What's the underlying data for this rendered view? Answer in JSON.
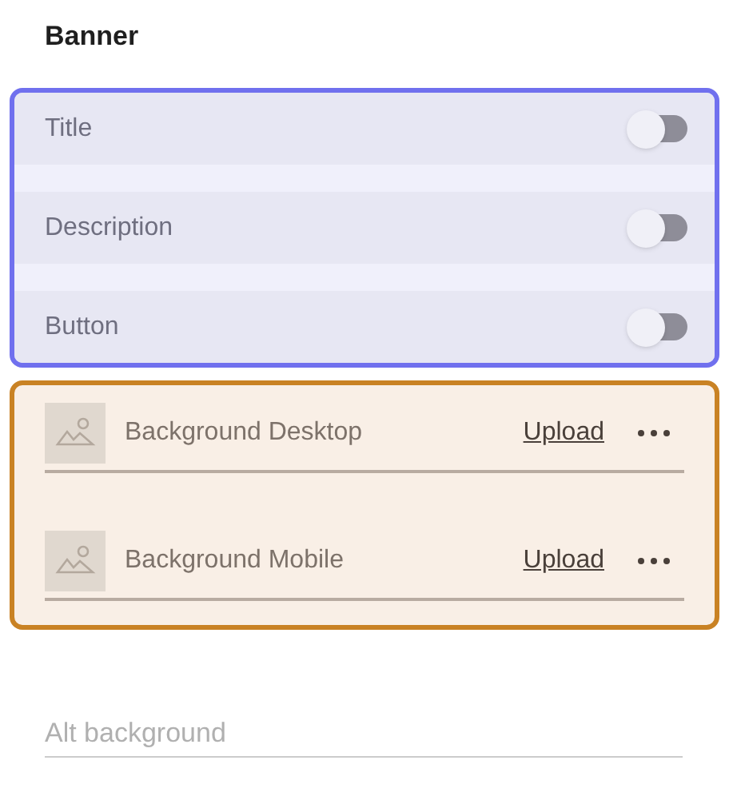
{
  "heading": "Banner",
  "toggles": [
    {
      "label": "Title",
      "on": false
    },
    {
      "label": "Description",
      "on": false
    },
    {
      "label": "Button",
      "on": false
    }
  ],
  "uploads": [
    {
      "label": "Background Desktop",
      "action": "Upload"
    },
    {
      "label": "Background Mobile",
      "action": "Upload"
    }
  ],
  "alt_field": {
    "placeholder": "Alt background"
  }
}
